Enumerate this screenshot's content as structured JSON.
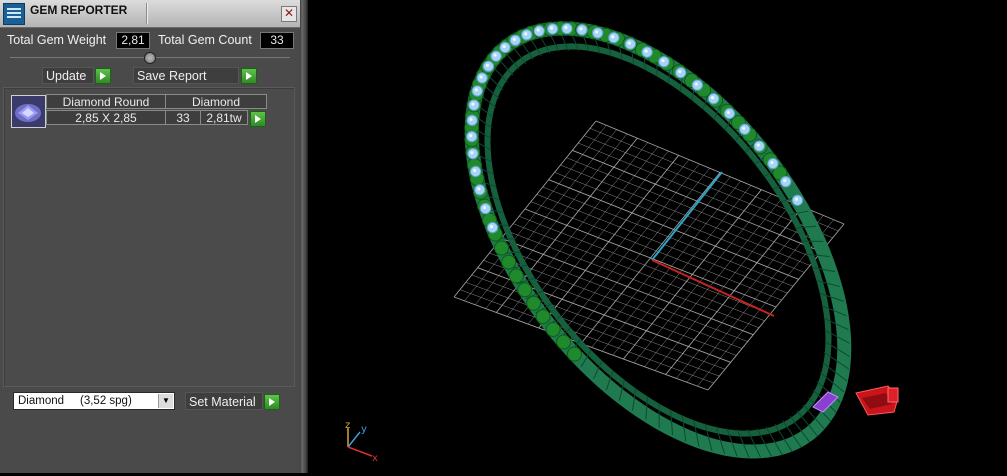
{
  "panel": {
    "title": "GEM REPORTER",
    "close_glyph": "✕",
    "total_weight_label": "Total Gem Weight",
    "total_weight_value": "2,81",
    "total_count_label": "Total Gem Count",
    "total_count_value": "33",
    "update_label": "Update",
    "save_report_label": "Save Report",
    "gem_row": {
      "name": "Diamond Round",
      "material": "Diamond",
      "size": "2,85 X 2,85",
      "count": "33",
      "weight": "2,81tw"
    },
    "material_select": "Diamond     (3,52 spg)",
    "set_material_label": "Set Material"
  },
  "viewport": {
    "axis_labels": {
      "z": "z",
      "y": "y",
      "x": "x"
    },
    "colors": {
      "background": "#000000",
      "grid": "#b8b8b8",
      "axis_x": "#c8231f",
      "axis_y": "#2aa3c9",
      "band": "#1f7a50",
      "prongs": "#1f8a2c",
      "stones": "#a6d4f5",
      "cutter": "#d2141b",
      "marker": "#8a3fd0"
    }
  },
  "icons": {
    "app": "gem-reporter-app-icon",
    "close": "close-icon",
    "go": "play-arrow-icon",
    "dropdown": "chevron-down-icon",
    "gem": "gem-icon"
  }
}
